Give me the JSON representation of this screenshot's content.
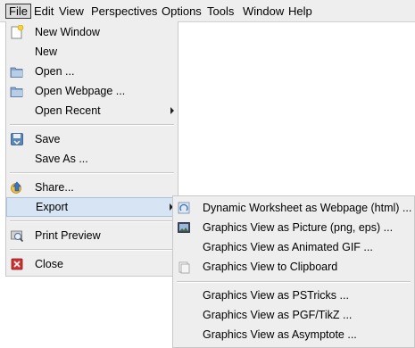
{
  "menubar": {
    "items": [
      {
        "label": "File"
      },
      {
        "label": "Edit"
      },
      {
        "label": "View"
      },
      {
        "label": "Perspectives"
      },
      {
        "label": "Options"
      },
      {
        "label": "Tools"
      },
      {
        "label": "Window"
      },
      {
        "label": "Help"
      }
    ]
  },
  "file_menu": {
    "new_window": "New Window",
    "new": "New",
    "open": "Open ...",
    "open_webpage": "Open Webpage ...",
    "open_recent": "Open Recent",
    "save": "Save",
    "save_as": "Save As ...",
    "share": "Share...",
    "export": "Export",
    "print_preview": "Print Preview",
    "close": "Close"
  },
  "export_menu": {
    "dynamic_worksheet": "Dynamic Worksheet as Webpage (html) ...",
    "graphics_picture": "Graphics View as Picture (png, eps) ...",
    "graphics_gif": "Graphics View as Animated GIF ...",
    "graphics_clipboard": "Graphics View to Clipboard",
    "graphics_pstricks": "Graphics View as PSTricks ...",
    "graphics_pgf": "Graphics View as PGF/TikZ ...",
    "graphics_asymptote": "Graphics View as Asymptote ..."
  },
  "colors": {
    "menu_bg": "#eeeeee",
    "highlight": "#d6e4f3",
    "close_icon": "#cc3333"
  }
}
